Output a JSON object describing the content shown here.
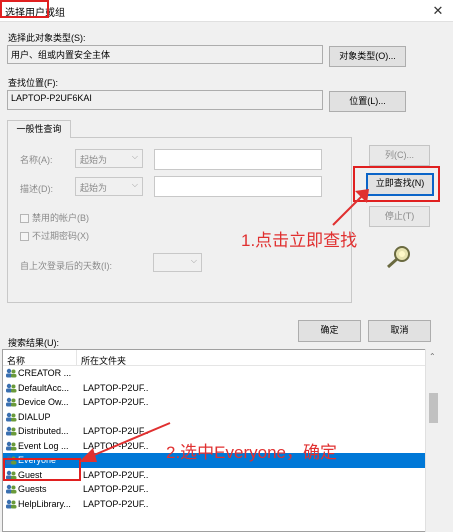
{
  "window": {
    "title": "选择用户或组",
    "close_glyph": "✕"
  },
  "object_type": {
    "label": "选择此对象类型(S):",
    "value": "用户、组或内置安全主体",
    "button": "对象类型(O)..."
  },
  "location": {
    "label": "查找位置(F):",
    "value": "LAPTOP-P2UF6KAI",
    "button": "位置(L)..."
  },
  "query": {
    "tab": "一般性查询",
    "name_label": "名称(A):",
    "name_mode": "起始为",
    "desc_label": "描述(D):",
    "desc_mode": "起始为",
    "disabled_accounts": "禁用的帐户(B)",
    "non_expiring_pw": "不过期密码(X)",
    "days_label": "自上次登录后的天数(I):",
    "columns_button": "列(C)...",
    "find_now_button": "立即查找(N)",
    "stop_button": "停止(T)"
  },
  "annotations": {
    "step1": "1.点击立即查找",
    "step2": "2.选中Everyone，确定"
  },
  "actions": {
    "ok": "确定",
    "cancel": "取消"
  },
  "results": {
    "label": "搜索结果(U):",
    "columns": [
      "名称",
      "所在文件夹"
    ],
    "rows": [
      {
        "name": "CREATOR ...",
        "folder": ""
      },
      {
        "name": "DefaultAcc...",
        "folder": "LAPTOP-P2UF..."
      },
      {
        "name": "Device Ow...",
        "folder": "LAPTOP-P2UF..."
      },
      {
        "name": "DIALUP",
        "folder": ""
      },
      {
        "name": "Distributed...",
        "folder": "LAPTOP-P2UF..."
      },
      {
        "name": "Event Log ...",
        "folder": "LAPTOP-P2UF..."
      },
      {
        "name": "Everyone",
        "folder": "",
        "selected": true
      },
      {
        "name": "Guest",
        "folder": "LAPTOP-P2UF..."
      },
      {
        "name": "Guests",
        "folder": "LAPTOP-P2UF..."
      },
      {
        "name": "HelpLibrary...",
        "folder": "LAPTOP-P2UF..."
      }
    ]
  },
  "colors": {
    "highlight_red": "#e03030",
    "selection_blue": "#0078d7",
    "focus_blue": "#0a64c8"
  },
  "icons": {
    "user": "user-group-icon",
    "search": "search-icon",
    "scroll_up": "chevron-up-icon",
    "scroll_down": "chevron-down-icon"
  }
}
